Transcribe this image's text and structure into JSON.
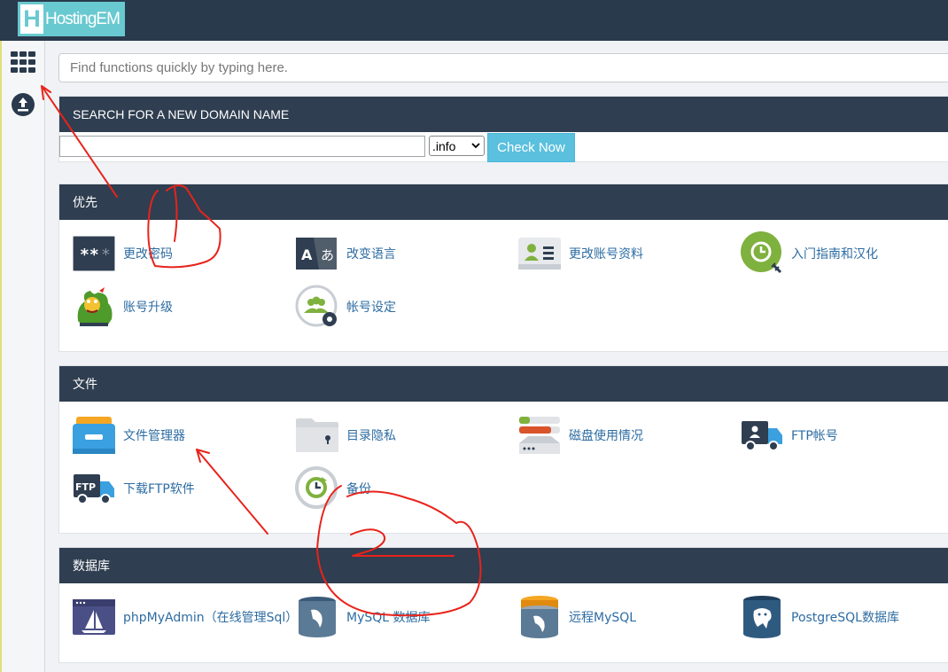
{
  "brand": {
    "letter": "H",
    "name": "HostingEM"
  },
  "sidebar": {
    "items": [
      {
        "icon": "grid-icon"
      },
      {
        "icon": "upload-icon"
      }
    ]
  },
  "search": {
    "placeholder": "Find functions quickly by typing here."
  },
  "domain": {
    "heading": "SEARCH FOR A NEW DOMAIN NAME",
    "input_value": "",
    "tld": ".info",
    "button": "Check Now"
  },
  "sections": [
    {
      "title": "优先",
      "items": [
        {
          "label": "更改密码",
          "icon": "password-icon"
        },
        {
          "label": "改变语言",
          "icon": "language-icon"
        },
        {
          "label": "更改账号资料",
          "icon": "contact-card-icon"
        },
        {
          "label": "入门指南和汉化",
          "icon": "getting-started-icon"
        },
        {
          "label": "账号升级",
          "icon": "dragon-upgrade-icon"
        },
        {
          "label": "帐号设定",
          "icon": "account-settings-icon"
        }
      ]
    },
    {
      "title": "文件",
      "items": [
        {
          "label": "文件管理器",
          "icon": "file-manager-icon"
        },
        {
          "label": "目录隐私",
          "icon": "directory-privacy-icon"
        },
        {
          "label": "磁盘使用情况",
          "icon": "disk-usage-icon"
        },
        {
          "label": "FTP帐号",
          "icon": "ftp-account-icon"
        },
        {
          "label": "下载FTP软件",
          "icon": "ftp-download-icon"
        },
        {
          "label": "备份",
          "icon": "backup-icon"
        }
      ]
    },
    {
      "title": "数据库",
      "items": [
        {
          "label": "phpMyAdmin（在线管理Sql）",
          "icon": "phpmyadmin-icon"
        },
        {
          "label": "MySQL 数据库",
          "icon": "mysql-database-icon"
        },
        {
          "label": "远程MySQL",
          "icon": "remote-mysql-icon"
        },
        {
          "label": "PostgreSQL数据库",
          "icon": "postgresql-icon"
        }
      ]
    }
  ],
  "annotations": {
    "color": "#e8231b"
  }
}
